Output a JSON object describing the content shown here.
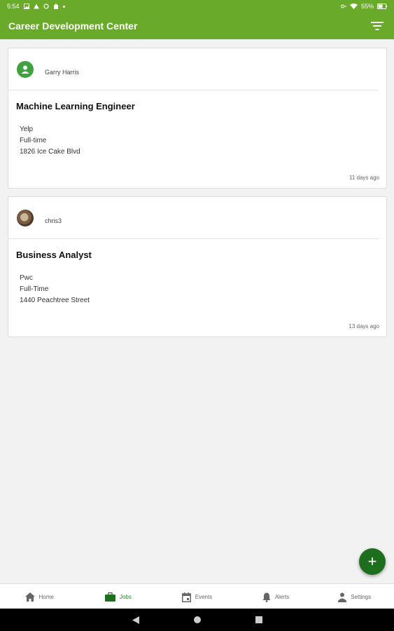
{
  "status_bar": {
    "time": "5:54",
    "battery": "55%"
  },
  "app_bar": {
    "title": "Career Development Center"
  },
  "jobs": [
    {
      "user": "Garry Harris",
      "title": "Machine Learning Engineer",
      "company": "Yelp",
      "type": "Full-time",
      "address": "1826 Ice Cake Blvd",
      "posted": "11 days ago"
    },
    {
      "user": "chris3",
      "title": "Business Analyst",
      "company": "Pwc",
      "type": "Full-Time",
      "address": "1440 Peachtree Street",
      "posted": "13 days ago"
    }
  ],
  "fab": {
    "label": "+"
  },
  "bottom_nav": [
    {
      "label": "Home",
      "icon": "home-icon",
      "active": false
    },
    {
      "label": "Jobs",
      "icon": "briefcase-icon",
      "active": true
    },
    {
      "label": "Events",
      "icon": "calendar-icon",
      "active": false
    },
    {
      "label": "Alerts",
      "icon": "bell-icon",
      "active": false
    },
    {
      "label": "Settings",
      "icon": "person-icon",
      "active": false
    }
  ],
  "colors": {
    "primary": "#6aaa2a",
    "accent": "#1d6f1d",
    "active_nav": "#2b7a2b"
  }
}
